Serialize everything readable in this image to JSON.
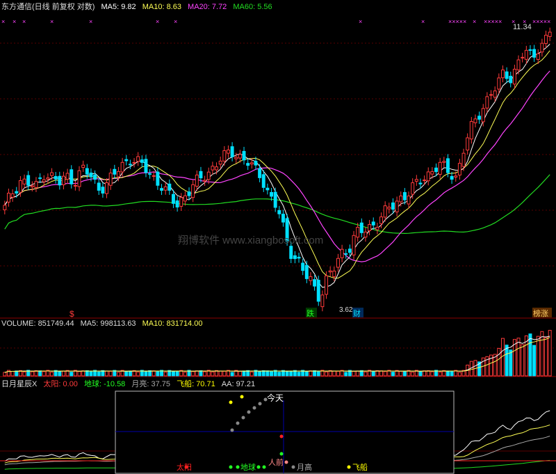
{
  "main_header": {
    "title": "东方通信(日线 前复权 对数)",
    "ma5": "MA5: 9.82",
    "ma10": "MA10: 8.63",
    "ma20": "MA20: 7.72",
    "ma60": "MA60: 5.56"
  },
  "vol_header": {
    "volume": "VOLUME: 851749.44",
    "ma5": "MA5: 998113.63",
    "ma10": "MA10: 831714.00"
  },
  "ind_header": {
    "name": "日月星辰X",
    "sun": "太阳: 0.00",
    "earth": "地球: -10.58",
    "moon": "月亮: 37.75",
    "ship": "飞船: 70.71",
    "aa": "AA: 97.21"
  },
  "annotations": {
    "price_high": "11.34",
    "low_label": "3.62",
    "dollar_marker": "$",
    "fall_tag": "跌",
    "wealth_tag": "财",
    "list_tag": "榜涨",
    "watermark": "翔博软件 www.xiangbosoft.com"
  },
  "popup": {
    "today": "今天",
    "sun": "太阳",
    "earth": "地球",
    "front": "人前",
    "moon": "月高",
    "ship": "飞船"
  },
  "colors": {
    "up": "#ff3b3b",
    "down": "#00e0ff",
    "ma5": "#ffffff",
    "ma10": "#ffff55",
    "ma20": "#ff44ff",
    "ma60": "#22dd22",
    "grid": "#8b0000",
    "sun": "#ff2020",
    "earth": "#22ff22",
    "ship": "#ffff00",
    "moon": "#aaaaaa"
  },
  "chart_data": {
    "type": "candlestick",
    "price_points": [
      5.2,
      5.6,
      5.9,
      5.8,
      5.7,
      6.1,
      6.0,
      5.8,
      6.0,
      5.9,
      6.2,
      6.0,
      5.7,
      5.8,
      6.0,
      6.3,
      6.5,
      6.4,
      6.2,
      6.0,
      5.8,
      5.5,
      5.3,
      5.5,
      5.7,
      5.9,
      6.1,
      6.3,
      6.5,
      6.7,
      6.6,
      6.4,
      6.2,
      6.0,
      5.5,
      5.2,
      4.6,
      4.3,
      4.0,
      3.8,
      3.6,
      3.7,
      3.9,
      4.2,
      4.4,
      4.6,
      4.7,
      4.8,
      5.0,
      5.1,
      5.3,
      5.5,
      5.6,
      5.8,
      6.0,
      6.2,
      6.3,
      6.1,
      6.0,
      6.8,
      7.5,
      7.9,
      8.5,
      8.8,
      9.5,
      9.2,
      10.0,
      10.4,
      10.2,
      10.8,
      11.34
    ],
    "high": 11.34,
    "low": 3.62
  }
}
